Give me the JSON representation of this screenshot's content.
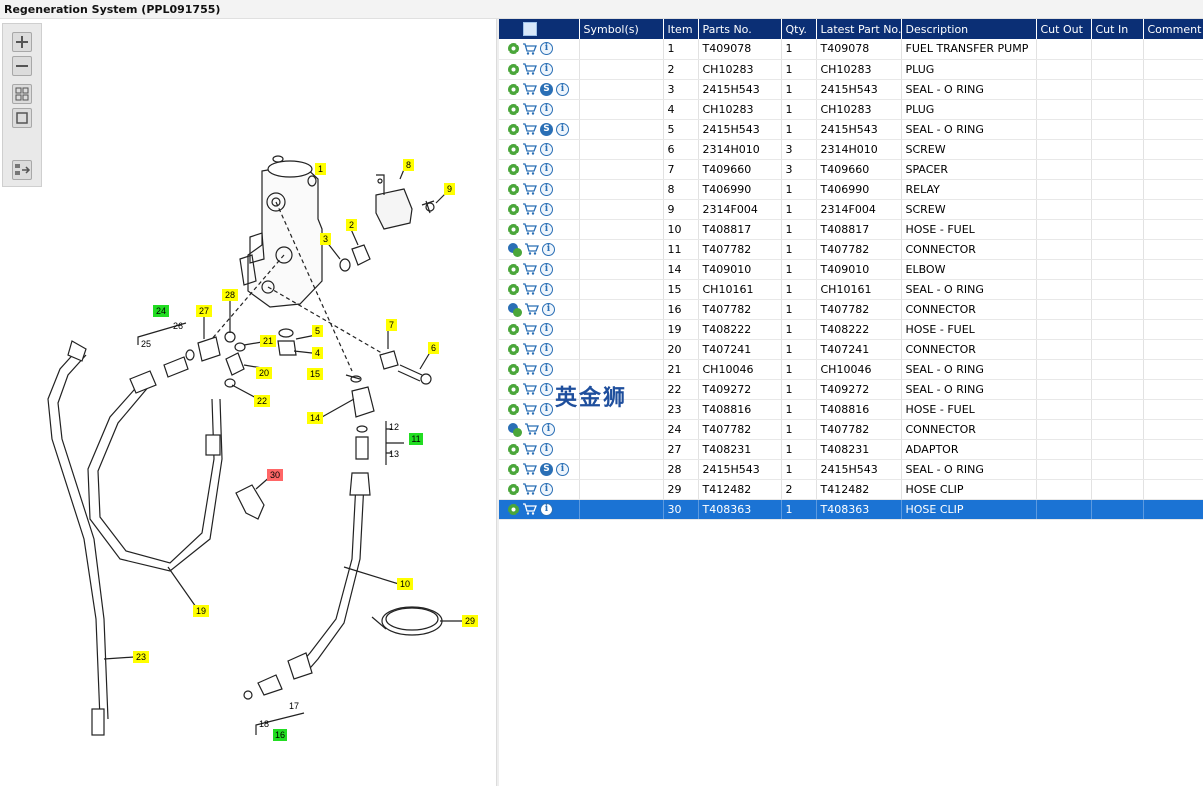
{
  "window": {
    "title": "Regeneration System (PPL091755)"
  },
  "toolbar": {
    "items": [
      "zoom-in",
      "zoom-out",
      "fit-all",
      "fit-page",
      "list-view"
    ]
  },
  "watermark": "英金狮",
  "diagram_labels": [
    {
      "id": "1",
      "color": "yellow"
    },
    {
      "id": "2",
      "color": "yellow"
    },
    {
      "id": "3",
      "color": "yellow"
    },
    {
      "id": "4",
      "color": "yellow"
    },
    {
      "id": "5",
      "color": "yellow"
    },
    {
      "id": "6",
      "color": "yellow"
    },
    {
      "id": "7",
      "color": "yellow"
    },
    {
      "id": "8",
      "color": "yellow"
    },
    {
      "id": "9",
      "color": "yellow"
    },
    {
      "id": "10",
      "color": "yellow"
    },
    {
      "id": "11",
      "color": "green"
    },
    {
      "id": "12",
      "color": "none"
    },
    {
      "id": "13",
      "color": "none"
    },
    {
      "id": "14",
      "color": "yellow"
    },
    {
      "id": "15",
      "color": "yellow"
    },
    {
      "id": "16",
      "color": "green"
    },
    {
      "id": "17",
      "color": "none"
    },
    {
      "id": "18",
      "color": "none"
    },
    {
      "id": "19",
      "color": "yellow"
    },
    {
      "id": "20",
      "color": "yellow"
    },
    {
      "id": "21",
      "color": "yellow"
    },
    {
      "id": "22",
      "color": "yellow"
    },
    {
      "id": "23",
      "color": "yellow"
    },
    {
      "id": "24",
      "color": "green"
    },
    {
      "id": "25",
      "color": "none"
    },
    {
      "id": "26",
      "color": "none"
    },
    {
      "id": "27",
      "color": "yellow"
    },
    {
      "id": "28",
      "color": "yellow"
    },
    {
      "id": "29",
      "color": "yellow"
    },
    {
      "id": "30",
      "color": "red"
    }
  ],
  "grid": {
    "columns": [
      "",
      "Symbol(s)",
      "Item",
      "Parts No.",
      "Qty.",
      "Latest Part No.",
      "Description",
      "Cut Out",
      "Cut In",
      "Comment"
    ],
    "rows": [
      {
        "icons": [
          "gear",
          "cart",
          "info"
        ],
        "item": "1",
        "part": "T409078",
        "qty": "1",
        "latest": "T409078",
        "desc": "FUEL TRANSFER PUMP"
      },
      {
        "icons": [
          "gear",
          "cart",
          "info"
        ],
        "item": "2",
        "part": "CH10283",
        "qty": "1",
        "latest": "CH10283",
        "desc": "PLUG"
      },
      {
        "icons": [
          "gear",
          "cart",
          "s",
          "info"
        ],
        "item": "3",
        "part": "2415H543",
        "qty": "1",
        "latest": "2415H543",
        "desc": "SEAL - O RING"
      },
      {
        "icons": [
          "gear",
          "cart",
          "info"
        ],
        "item": "4",
        "part": "CH10283",
        "qty": "1",
        "latest": "CH10283",
        "desc": "PLUG"
      },
      {
        "icons": [
          "gear",
          "cart",
          "s",
          "info"
        ],
        "item": "5",
        "part": "2415H543",
        "qty": "1",
        "latest": "2415H543",
        "desc": "SEAL - O RING"
      },
      {
        "icons": [
          "gear",
          "cart",
          "info"
        ],
        "item": "6",
        "part": "2314H010",
        "qty": "3",
        "latest": "2314H010",
        "desc": "SCREW"
      },
      {
        "icons": [
          "gear",
          "cart",
          "info"
        ],
        "item": "7",
        "part": "T409660",
        "qty": "3",
        "latest": "T409660",
        "desc": "SPACER"
      },
      {
        "icons": [
          "gear",
          "cart",
          "info"
        ],
        "item": "8",
        "part": "T406990",
        "qty": "1",
        "latest": "T406990",
        "desc": "RELAY"
      },
      {
        "icons": [
          "gear",
          "cart",
          "info"
        ],
        "item": "9",
        "part": "2314F004",
        "qty": "1",
        "latest": "2314F004",
        "desc": "SCREW"
      },
      {
        "icons": [
          "gear",
          "cart",
          "info"
        ],
        "item": "10",
        "part": "T408817",
        "qty": "1",
        "latest": "T408817",
        "desc": "HOSE - FUEL"
      },
      {
        "icons": [
          "gears",
          "cart",
          "info"
        ],
        "item": "11",
        "part": "T407782",
        "qty": "1",
        "latest": "T407782",
        "desc": "CONNECTOR"
      },
      {
        "icons": [
          "gear",
          "cart",
          "info"
        ],
        "item": "14",
        "part": "T409010",
        "qty": "1",
        "latest": "T409010",
        "desc": "ELBOW"
      },
      {
        "icons": [
          "gear",
          "cart",
          "info"
        ],
        "item": "15",
        "part": "CH10161",
        "qty": "1",
        "latest": "CH10161",
        "desc": "SEAL - O RING"
      },
      {
        "icons": [
          "gears",
          "cart",
          "info"
        ],
        "item": "16",
        "part": "T407782",
        "qty": "1",
        "latest": "T407782",
        "desc": "CONNECTOR"
      },
      {
        "icons": [
          "gear",
          "cart",
          "info"
        ],
        "item": "19",
        "part": "T408222",
        "qty": "1",
        "latest": "T408222",
        "desc": "HOSE - FUEL"
      },
      {
        "icons": [
          "gear",
          "cart",
          "info"
        ],
        "item": "20",
        "part": "T407241",
        "qty": "1",
        "latest": "T407241",
        "desc": "CONNECTOR"
      },
      {
        "icons": [
          "gear",
          "cart",
          "info"
        ],
        "item": "21",
        "part": "CH10046",
        "qty": "1",
        "latest": "CH10046",
        "desc": "SEAL - O RING"
      },
      {
        "icons": [
          "gear",
          "cart",
          "info"
        ],
        "item": "22",
        "part": "T409272",
        "qty": "1",
        "latest": "T409272",
        "desc": "SEAL - O RING"
      },
      {
        "icons": [
          "gear",
          "cart",
          "info"
        ],
        "item": "23",
        "part": "T408816",
        "qty": "1",
        "latest": "T408816",
        "desc": "HOSE - FUEL"
      },
      {
        "icons": [
          "gears",
          "cart",
          "info"
        ],
        "item": "24",
        "part": "T407782",
        "qty": "1",
        "latest": "T407782",
        "desc": "CONNECTOR"
      },
      {
        "icons": [
          "gear",
          "cart",
          "info"
        ],
        "item": "27",
        "part": "T408231",
        "qty": "1",
        "latest": "T408231",
        "desc": "ADAPTOR"
      },
      {
        "icons": [
          "gear",
          "cart",
          "s",
          "info"
        ],
        "item": "28",
        "part": "2415H543",
        "qty": "1",
        "latest": "2415H543",
        "desc": "SEAL - O RING"
      },
      {
        "icons": [
          "gear",
          "cart",
          "info"
        ],
        "item": "29",
        "part": "T412482",
        "qty": "2",
        "latest": "T412482",
        "desc": "HOSE CLIP"
      },
      {
        "icons": [
          "gear",
          "cart",
          "info"
        ],
        "item": "30",
        "part": "T408363",
        "qty": "1",
        "latest": "T408363",
        "desc": "HOSE CLIP",
        "selected": true
      }
    ]
  },
  "colors": {
    "header_bg": "#0b2f75",
    "selected_bg": "#1b73d4",
    "label_yellow": "#ffff00",
    "label_green": "#22dd22",
    "label_red": "#ff6666"
  }
}
